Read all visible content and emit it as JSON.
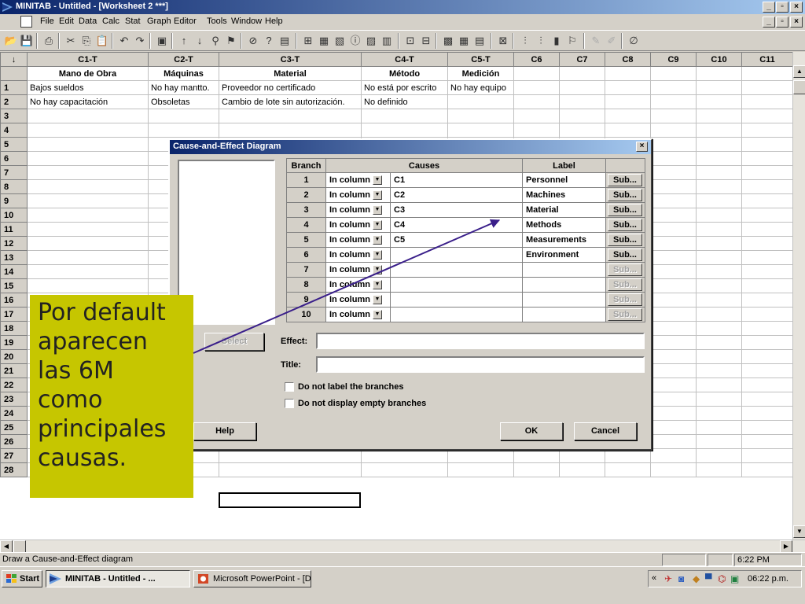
{
  "window": {
    "title": "MINITAB - Untitled - [Worksheet 2 ***]"
  },
  "menu": [
    "File",
    "Edit",
    "Data",
    "Calc",
    "Stat",
    "Graph",
    "Editor",
    "Tools",
    "Window",
    "Help"
  ],
  "worksheet": {
    "columns": [
      "C1-T",
      "C2-T",
      "C3-T",
      "C4-T",
      "C5-T",
      "C6",
      "C7",
      "C8",
      "C9",
      "C10",
      "C11"
    ],
    "column_names": [
      "Mano de Obra",
      "Máquinas",
      "Material",
      "Método",
      "Medición",
      "",
      "",
      "",
      "",
      "",
      ""
    ],
    "rows": [
      [
        "Bajos sueldos",
        "No hay mantto.",
        "Proveedor no certificado",
        "No está por escrito",
        "No hay equipo",
        "",
        "",
        "",
        "",
        "",
        ""
      ],
      [
        "No hay capacitación",
        "Obsoletas",
        "Cambio de lote sin autorización.",
        "No definido",
        "",
        "",
        "",
        "",
        "",
        "",
        ""
      ]
    ],
    "row_numbers": [
      "1",
      "2",
      "3",
      "4",
      "5",
      "6",
      "7",
      "8",
      "9",
      "10",
      "11",
      "12",
      "13",
      "14",
      "15",
      "16",
      "17",
      "18",
      "19",
      "20",
      "21",
      "22",
      "23",
      "24",
      "25",
      "26",
      "27",
      "28"
    ],
    "corner_arrow": "↓"
  },
  "dialog": {
    "title": "Cause-and-Effect Diagram",
    "headers": {
      "branch": "Branch",
      "causes": "Causes",
      "label": "Label"
    },
    "branches": [
      {
        "num": "1",
        "mode": "In column",
        "cause": "C1",
        "label": "Personnel",
        "sub": "Sub..."
      },
      {
        "num": "2",
        "mode": "In column",
        "cause": "C2",
        "label": "Machines",
        "sub": "Sub..."
      },
      {
        "num": "3",
        "mode": "In column",
        "cause": "C3",
        "label": "Material",
        "sub": "Sub..."
      },
      {
        "num": "4",
        "mode": "In column",
        "cause": "C4",
        "label": "Methods",
        "sub": "Sub..."
      },
      {
        "num": "5",
        "mode": "In column",
        "cause": "C5",
        "label": "Measurements",
        "sub": "Sub..."
      },
      {
        "num": "6",
        "mode": "In column",
        "cause": "",
        "label": "Environment",
        "sub": "Sub..."
      },
      {
        "num": "7",
        "mode": "In column",
        "cause": "",
        "label": "",
        "sub": "Sub..."
      },
      {
        "num": "8",
        "mode": "In column",
        "cause": "",
        "label": "",
        "sub": "Sub..."
      },
      {
        "num": "9",
        "mode": "In column",
        "cause": "",
        "label": "",
        "sub": "Sub..."
      },
      {
        "num": "10",
        "mode": "In column",
        "cause": "",
        "label": "",
        "sub": "Sub..."
      }
    ],
    "select_label": "Select",
    "effect_label": "Effect:",
    "effect_value": "",
    "title_label": "Title:",
    "title_value": "",
    "chk_no_label": "Do not label the branches",
    "chk_no_empty": "Do not display empty branches",
    "help_label": "Help",
    "ok_label": "OK",
    "cancel_label": "Cancel",
    "close_label": "×"
  },
  "callout": {
    "text": "Por default aparecen las 6M como principales causas."
  },
  "status": {
    "text": "Draw a Cause-and-Effect diagram",
    "time": "6:22 PM"
  },
  "taskbar": {
    "start": "Start",
    "task1": "MINITAB - Untitled - ...",
    "task2": "Microsoft PowerPoint - [Di...",
    "clock": "06:22 p.m.",
    "tray_chevron": "«"
  },
  "colors": {
    "callout": "#c6c600",
    "arrow": "#3a1f8a",
    "titlebar": "#0a246a"
  }
}
